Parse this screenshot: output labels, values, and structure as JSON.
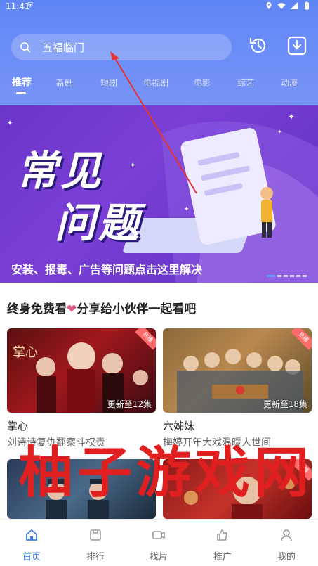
{
  "status": {
    "time": "11:41"
  },
  "search": {
    "placeholder": "五福临门"
  },
  "tabs": [
    "推荐",
    "新剧",
    "短剧",
    "电视剧",
    "电影",
    "综艺",
    "动漫"
  ],
  "banner": {
    "big_line1": "常见",
    "big_line2": "问题",
    "caption": "安装、报毒、广告等问题点击这里解决"
  },
  "promo": {
    "before": "终身免费看",
    "heart": "❤",
    "after": "分享给小伙伴一起看吧"
  },
  "cards": [
    {
      "badge": "热播",
      "episodes": "更新至12集",
      "title": "掌心",
      "desc": "刘诗诗复仇翻案斗权贵"
    },
    {
      "badge": "热播",
      "episodes": "更新至18集",
      "title": "六姊妹",
      "desc": "梅婷开年大戏温暖人世间"
    },
    {
      "badge": "",
      "episodes": "",
      "title": "",
      "desc": ""
    },
    {
      "badge": "热播",
      "episodes": "",
      "title": "",
      "desc": ""
    }
  ],
  "watermark": "柚子游戏网",
  "nav": [
    {
      "label": "首页",
      "icon": "home-icon",
      "active": true
    },
    {
      "label": "排行",
      "icon": "ranking-icon",
      "active": false
    },
    {
      "label": "找片",
      "icon": "video-icon",
      "active": false
    },
    {
      "label": "推广",
      "icon": "thumbs-up-icon",
      "active": false
    },
    {
      "label": "我的",
      "icon": "user-icon",
      "active": false
    }
  ]
}
